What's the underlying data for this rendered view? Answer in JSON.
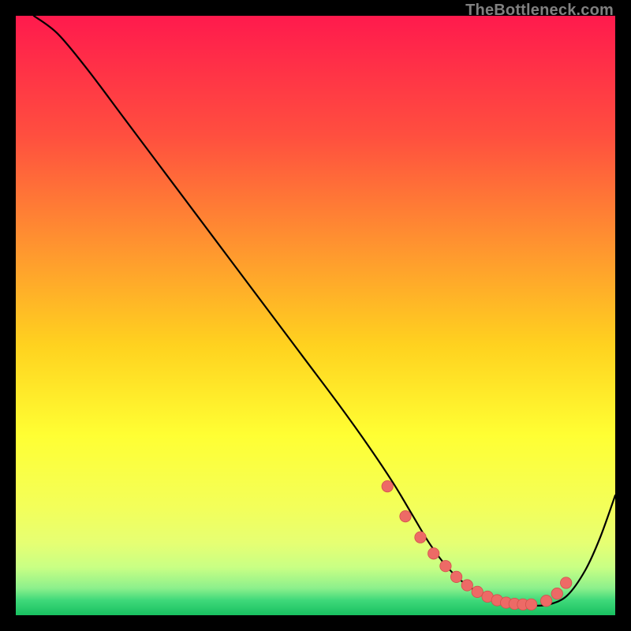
{
  "watermark": "TheBottleneck.com",
  "chart_data": {
    "type": "line",
    "title": "",
    "xlabel": "",
    "ylabel": "",
    "xlim": [
      0,
      100
    ],
    "ylim": [
      0,
      100
    ],
    "grid": false,
    "legend": false,
    "background_gradient": {
      "stops": [
        {
          "offset": 0.0,
          "color": "#ff1a4d"
        },
        {
          "offset": 0.2,
          "color": "#ff4f3f"
        },
        {
          "offset": 0.4,
          "color": "#ff9a2e"
        },
        {
          "offset": 0.55,
          "color": "#ffd21f"
        },
        {
          "offset": 0.7,
          "color": "#ffff33"
        },
        {
          "offset": 0.82,
          "color": "#f3ff5a"
        },
        {
          "offset": 0.88,
          "color": "#e6ff73"
        },
        {
          "offset": 0.92,
          "color": "#c9ff84"
        },
        {
          "offset": 0.955,
          "color": "#8cf08c"
        },
        {
          "offset": 0.975,
          "color": "#3fd97a"
        },
        {
          "offset": 1.0,
          "color": "#18c060"
        }
      ]
    },
    "series": [
      {
        "name": "bottleneck-curve",
        "x": [
          3,
          7,
          12,
          18,
          24,
          30,
          36,
          42,
          48,
          54,
          59,
          63,
          66,
          69,
          72,
          75,
          78,
          81,
          84,
          86.5,
          89,
          92,
          95,
          97.5,
          100
        ],
        "y": [
          100,
          97,
          91,
          83,
          75,
          67,
          59,
          51,
          43,
          35,
          28,
          22,
          17,
          12,
          8,
          5.2,
          3.4,
          2.2,
          1.7,
          1.6,
          1.8,
          3.3,
          7.5,
          13,
          20
        ]
      }
    ],
    "highlight_points": {
      "name": "bottom-dots",
      "x": [
        62,
        65,
        67.5,
        69.7,
        71.7,
        73.5,
        75.3,
        77,
        78.7,
        80.3,
        81.8,
        83.2,
        84.6,
        86,
        88.5,
        90.3,
        91.8
      ],
      "y": [
        21.5,
        16.5,
        13,
        10.3,
        8.2,
        6.4,
        5.0,
        3.9,
        3.1,
        2.5,
        2.1,
        1.9,
        1.8,
        1.8,
        2.4,
        3.6,
        5.4
      ]
    }
  }
}
